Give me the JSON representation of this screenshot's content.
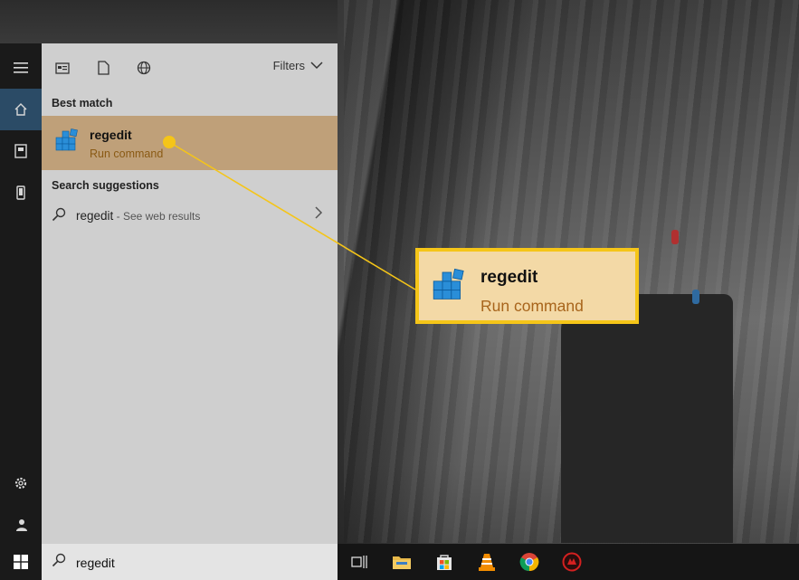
{
  "toolbar": {
    "filters_label": "Filters"
  },
  "sections": {
    "best_match": "Best match",
    "search_suggestions": "Search suggestions"
  },
  "best_match_item": {
    "title": "regedit",
    "subtitle": "Run command"
  },
  "suggestion": {
    "query": "regedit",
    "hint": " - See web results"
  },
  "search": {
    "value": "regedit"
  },
  "callout": {
    "title": "regedit",
    "subtitle": "Run command"
  },
  "colors": {
    "callout_border": "#f5c518",
    "accent_rail": "#2b4b66",
    "best_match_bg": "#bfa079"
  },
  "icons": {
    "rail": [
      "menu-icon",
      "home-icon",
      "documents-icon",
      "phone-icon",
      "settings-icon",
      "user-icon"
    ],
    "toolbar": [
      "apps-icon",
      "document-icon",
      "web-icon"
    ],
    "taskbar": [
      "task-view-icon",
      "file-explorer-icon",
      "store-icon",
      "vlc-icon",
      "chrome-icon",
      "app-icon"
    ]
  }
}
